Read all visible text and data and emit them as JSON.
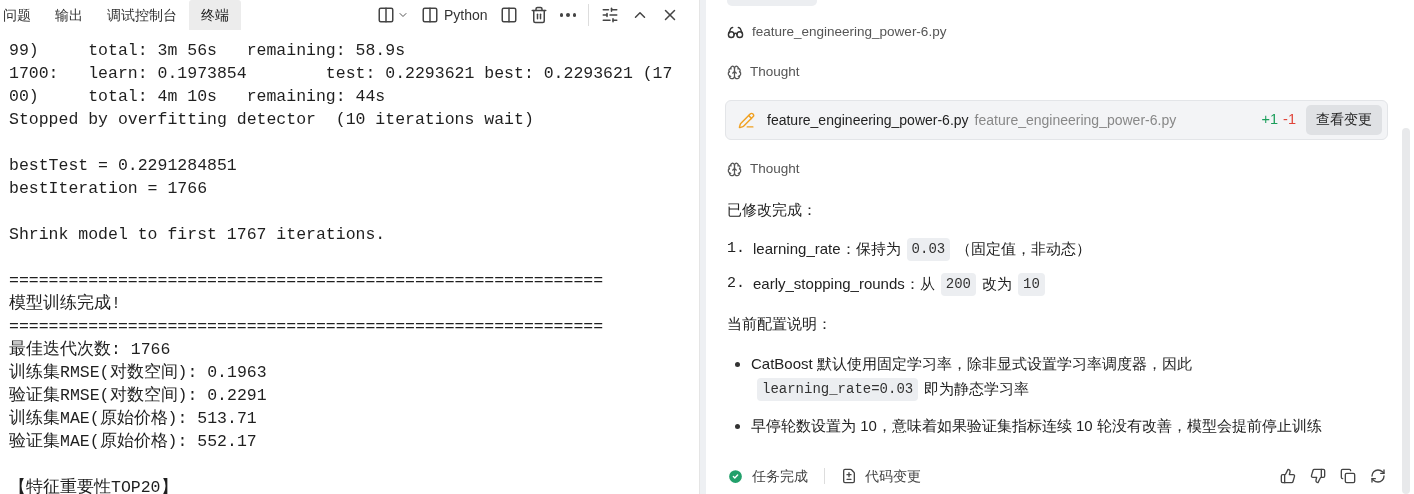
{
  "panel_tabs": [
    {
      "label": "问题",
      "selected": false
    },
    {
      "label": "输出",
      "selected": false
    },
    {
      "label": "调试控制台",
      "selected": false
    },
    {
      "label": "终端",
      "selected": true
    }
  ],
  "terminal_toolbar": {
    "shell": "Python"
  },
  "terminal_blocks": [
    {
      "lines": [
        "99)     total: 3m 56s   remaining: 58.9s",
        "1700:   learn: 0.1973854        test: 0.2293621 best: 0.2293621 (17",
        "00)     total: 4m 10s   remaining: 44s",
        "Stopped by overfitting detector  (10 iterations wait)"
      ]
    },
    {
      "lines": [
        "bestTest = 0.2291284851",
        "bestIteration = 1766"
      ]
    },
    {
      "lines": [
        "Shrink model to first 1767 iterations."
      ]
    },
    {
      "lines": [
        "============================================================",
        "模型训练完成!",
        "============================================================",
        "最佳迭代次数: 1766",
        "训练集RMSE(对数空间): 0.1963",
        "验证集RMSE(对数空间): 0.2291",
        "训练集MAE(原始价格): 513.71",
        "验证集MAE(原始价格): 552.17"
      ]
    },
    {
      "lines": [
        "【特征重要性TOP20】"
      ]
    }
  ],
  "chat": {
    "read_file": "feature_engineering_power-6.py",
    "thought_1": "Thought",
    "edit_card": {
      "file": "feature_engineering_power-6.py",
      "path": "feature_engineering_power-6.py",
      "added": "+1",
      "removed": "-1",
      "button": "查看变更"
    },
    "thought_2": "Thought",
    "summary": "已修改完成：",
    "numbered": [
      {
        "marker": "1.",
        "parts": [
          {
            "kind": "text",
            "text": "learning_rate：保持为"
          },
          {
            "kind": "code",
            "text": "0.03"
          },
          {
            "kind": "text",
            "text": "（固定值，非动态）"
          }
        ]
      },
      {
        "marker": "2.",
        "parts": [
          {
            "kind": "text",
            "text": "early_stopping_rounds：从"
          },
          {
            "kind": "code",
            "text": "200"
          },
          {
            "kind": "text",
            "text": "改为"
          },
          {
            "kind": "code",
            "text": "10"
          }
        ]
      }
    ],
    "config_heading": "当前配置说明：",
    "bullets": [
      {
        "lines": [
          [
            {
              "kind": "text",
              "text": "CatBoost 默认使用固定学习率，除非显式设置学习率调度器，因此"
            }
          ],
          [
            {
              "kind": "code",
              "text": "learning_rate=0.03"
            },
            {
              "kind": "text",
              "text": "即为静态学习率"
            }
          ]
        ]
      },
      {
        "lines": [
          [
            {
              "kind": "text",
              "text": "早停轮数设置为 10，意味着如果验证集指标连续 10 轮没有改善，模型会提前停止训练"
            }
          ]
        ]
      }
    ],
    "footer": {
      "status": "任务完成",
      "changes": "代码变更"
    }
  }
}
